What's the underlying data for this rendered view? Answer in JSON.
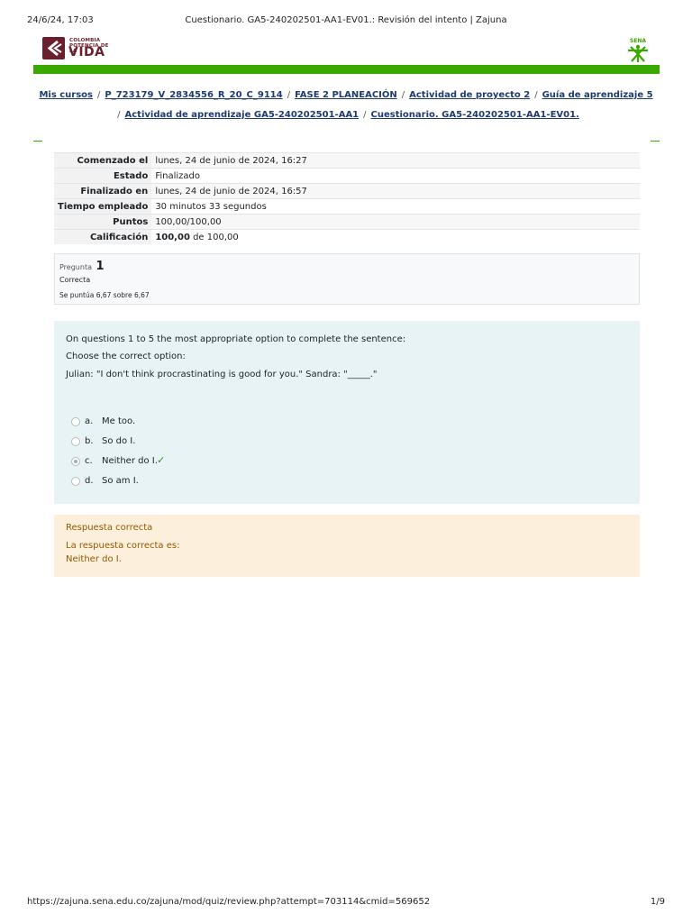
{
  "print": {
    "date": "24/6/24, 17:03",
    "title": "Cuestionario. GA5-240202501-AA1-EV01.: Revisión del intento | Zajuna",
    "url": "https://zajuna.sena.edu.co/zajuna/mod/quiz/review.php?attempt=703114&cmid=569652",
    "page": "1/9"
  },
  "logos": {
    "left_small": "COLOMBIA\nPOTENCIA DE LA",
    "left_big": "VIDA",
    "right": "SENA"
  },
  "colors": {
    "accent": "#39a900",
    "question_bg": "#e7f3f5",
    "feedback_bg": "#fcefdc"
  },
  "breadcrumb": {
    "items": [
      "Mis cursos",
      "P_723179_V_2834556_R_20_C_9114",
      "FASE 2 PLANEACIÓN",
      "Actividad de proyecto 2",
      "Guía de aprendizaje 5",
      "Actividad de aprendizaje GA5-240202501-AA1",
      "Cuestionario. GA5-240202501-AA1-EV01."
    ],
    "separator": "/"
  },
  "summary": [
    {
      "label": "Comenzado el",
      "value": "lunes, 24 de junio de 2024, 16:27"
    },
    {
      "label": "Estado",
      "value": "Finalizado"
    },
    {
      "label": "Finalizado en",
      "value": "lunes, 24 de junio de 2024, 16:57"
    },
    {
      "label": "Tiempo empleado",
      "value": "30 minutos 33 segundos"
    },
    {
      "label": "Puntos",
      "value": "100,00/100,00"
    },
    {
      "label": "Calificación",
      "value_bold": "100,00",
      "value_rest": " de 100,00"
    }
  ],
  "question": {
    "label": "Pregunta",
    "number": "1",
    "state": "Correcta",
    "grade": "Se puntúa 6,67 sobre 6,67",
    "text": [
      "On questions 1 to 5 the most appropriate option to complete the sentence:",
      "Choose the correct option:",
      "Julian: \"I don't think procrastinating is good for you.\" Sandra: \"_____.\""
    ],
    "options": [
      {
        "letter": "a.",
        "text": "Me too.",
        "selected": false
      },
      {
        "letter": "b.",
        "text": "So do I.",
        "selected": false
      },
      {
        "letter": "c.",
        "text": "Neither do I.",
        "selected": true
      },
      {
        "letter": "d.",
        "text": "So am I.",
        "selected": false
      }
    ],
    "check_icon": "check-icon"
  },
  "feedback": {
    "title": "Respuesta correcta",
    "right_answer_label": "La respuesta correcta es:",
    "right_answer": "Neither do I."
  }
}
